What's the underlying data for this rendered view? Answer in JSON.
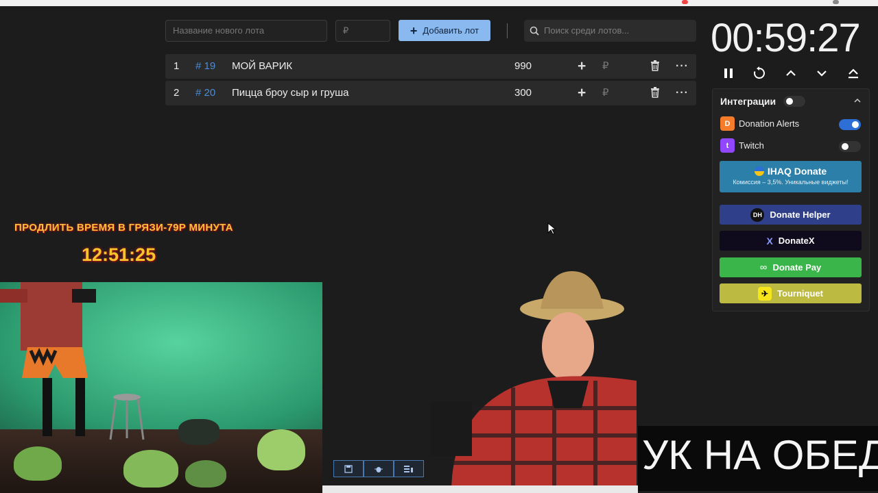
{
  "toolbar": {
    "new_lot_placeholder": "Название нового лота",
    "price_placeholder": "₽",
    "add_button_label": "Добавить лот",
    "search_placeholder": "Поиск среди лотов..."
  },
  "lots": [
    {
      "index": "1",
      "id": "# 19",
      "name": "МОЙ ВАРИК",
      "amount": "990",
      "currency": "₽"
    },
    {
      "index": "2",
      "id": "# 20",
      "name": "Пицца броу сыр и груша",
      "amount": "300",
      "currency": "₽"
    }
  ],
  "timer": {
    "value": "00:59:27"
  },
  "integrations": {
    "title": "Интеграции",
    "enabled": false,
    "items": [
      {
        "name": "Donation Alerts",
        "icon": "donation-alerts-icon",
        "enabled": true
      },
      {
        "name": "Twitch",
        "icon": "twitch-icon",
        "enabled": false
      }
    ],
    "ihaq": {
      "title": "IHAQ Donate",
      "subtitle": "Комиссия – 3,5%. Уникальные виджеты!"
    },
    "buttons": [
      {
        "label": "Donate Helper",
        "icon_text": "DH",
        "color": "#2f3f8a"
      },
      {
        "label": "DonateX",
        "icon_text": "X",
        "color": "#0f0a1c"
      },
      {
        "label": "Donate Pay",
        "icon_text": "∞",
        "color": "#39b54a"
      },
      {
        "label": "Tourniquet",
        "icon_text": "",
        "color": "#bcba40"
      }
    ]
  },
  "overlay": {
    "extend_time_text": "ПРОДЛИТЬ ВРЕМЯ В ГРЯЗИ-79Р МИНУТА",
    "stream_clock": "12:51:25",
    "banner_text": "УК НА ОБЕД"
  },
  "colors": {
    "accent": "#8ab9f0",
    "lot_id": "#4a8ed9",
    "overlay_text": "#f5c03b",
    "toggle_on": "#2d6fd6"
  }
}
